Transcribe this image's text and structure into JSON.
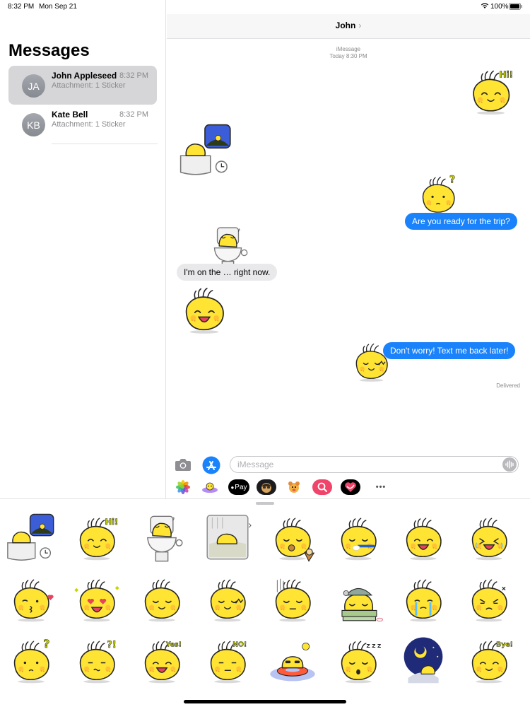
{
  "status_bar": {
    "time": "8:32 PM",
    "date": "Mon Sep 21",
    "battery": "100%"
  },
  "sidebar": {
    "title": "Messages",
    "conversations": [
      {
        "initials": "JA",
        "name": "John Appleseed",
        "time": "8:32 PM",
        "preview": "Attachment: 1 Sticker",
        "selected": true
      },
      {
        "initials": "KB",
        "name": "Kate Bell",
        "time": "8:32 PM",
        "preview": "Attachment: 1 Sticker",
        "selected": false
      }
    ]
  },
  "thread": {
    "contact": "John",
    "chevron": "›",
    "service": "iMessage",
    "timestamp": "Today 8:30 PM",
    "messages": [
      {
        "from": "me",
        "text": "Are you ready for the trip?"
      },
      {
        "from": "them",
        "text": "I'm on the … right now."
      },
      {
        "from": "me",
        "text": "Don't worry! Text me back later!"
      }
    ],
    "stickers_shown": [
      "sticker-hi",
      "sticker-bathtub-night",
      "sticker-question",
      "sticker-toilet",
      "sticker-laughing",
      "sticker-embarrassed"
    ],
    "delivered": "Delivered"
  },
  "composer": {
    "placeholder": "iMessage",
    "apps": [
      "photos-icon",
      "memoji-sticker-icon",
      "apple-pay-icon",
      "memoji-icon",
      "animoji-icon",
      "search-images-icon",
      "digital-touch-icon",
      "more-icon"
    ],
    "apple_pay_label": "Pay",
    "more_label": "•••"
  },
  "sticker_drawer": {
    "stickers": [
      "sticker-bathtub-night",
      "sticker-hi",
      "sticker-toilet",
      "sticker-shower",
      "sticker-eating-cupcake",
      "sticker-brushing-teeth",
      "sticker-laughing",
      "sticker-happy-tears",
      "sticker-kiss-heart",
      "sticker-heart-eyes",
      "sticker-smile",
      "sticker-embarrassed",
      "sticker-gloomy",
      "sticker-sleepy-blanket",
      "sticker-crying",
      "sticker-angry",
      "sticker-question",
      "sticker-confused",
      "sticker-yes",
      "sticker-no",
      "sticker-swim-ring",
      "sticker-sleeping",
      "sticker-night-sleep",
      "sticker-bye"
    ],
    "texts": {
      "hi": "Hi!",
      "yes": "Yes!",
      "no": "NO!",
      "bye": "Bye!",
      "q": "?",
      "qq": "?!",
      "zzz": "Z Z Z"
    }
  },
  "colors": {
    "accent": "#1a82fb",
    "sticker_yellow": "#ffe433",
    "sticker_outline": "#262626",
    "bubble_gray": "#e9e9eb"
  }
}
